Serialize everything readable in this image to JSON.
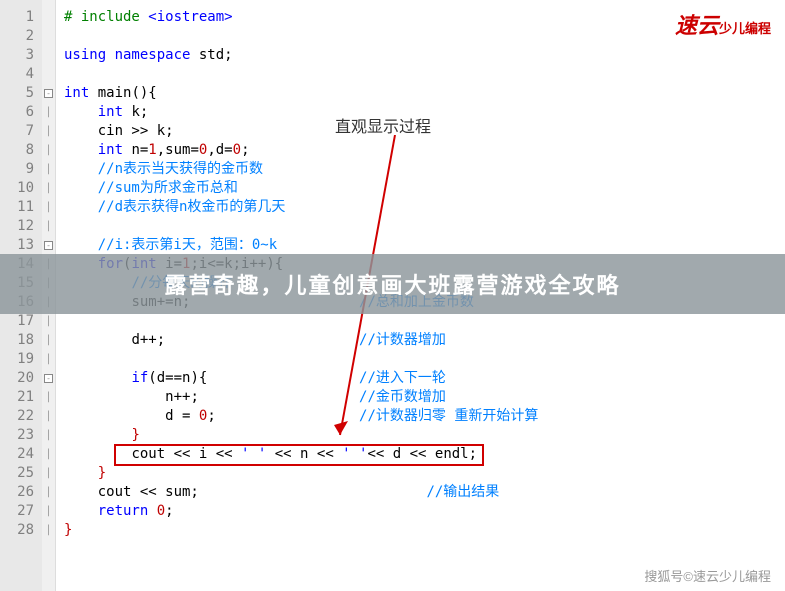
{
  "logo": {
    "brand": "速云",
    "tagline": "少儿编程"
  },
  "annotation": "直观显示过程",
  "banner": "露营奇趣，儿童创意画大班露营游戏全攻略",
  "watermark": "搜狐号©速云少儿编程",
  "gutter": [
    "1",
    "2",
    "3",
    "4",
    "5",
    "6",
    "7",
    "8",
    "9",
    "10",
    "11",
    "12",
    "13",
    "14",
    "15",
    "16",
    "17",
    "18",
    "19",
    "20",
    "21",
    "22",
    "23",
    "24",
    "25",
    "26",
    "27",
    "28"
  ],
  "fold": {
    "5": "-",
    "13": "-",
    "20": "-"
  },
  "code": {
    "l1": {
      "pp": "# include ",
      "str": "<iostream>"
    },
    "l3": {
      "kw1": "using ",
      "kw2": "namespace ",
      "id": "std",
      ";": ";"
    },
    "l5": {
      "kw": "int ",
      "id": "main",
      "rest": "(){"
    },
    "l6": {
      "kw": "int ",
      "rest": "k;"
    },
    "l7": "cin >> k;",
    "l8": {
      "kw": "int ",
      "rest": "n=",
      "n1": "1",
      "mid": ",sum=",
      "n2": "0",
      "mid2": ",d=",
      "n3": "0",
      "end": ";"
    },
    "l9": "//n表示当天获得的金币数",
    "l10": "//sum为所求金币总和",
    "l11": "//d表示获得n枚金币的第几天",
    "l13": "//i:表示第i天，范围：0~k",
    "l14": {
      "kw": "for",
      "rest": "(",
      "kw2": "int ",
      "body": "i=",
      "n": "1",
      "tail": ";i<=k;i++){"
    },
    "l15": "//分每天的操作",
    "l16": {
      "code": "sum+=n;",
      "cm": "//总和加上金币数"
    },
    "l18": {
      "code": "d++;",
      "cm": "//计数器增加"
    },
    "l20": {
      "kw": "if",
      "rest": "(d==n){",
      "cm": "//进入下一轮"
    },
    "l21": {
      "code": "n++;",
      "cm": "//金币数增加"
    },
    "l22": {
      "code": "d = ",
      "n": "0",
      "end": ";",
      "cm": "//计数器归零 重新开始计算"
    },
    "l23": "}",
    "l24": {
      "a": "cout << i << ",
      "q1": "' '",
      "b": " << n << ",
      "q2": "' '",
      "c": "<< d << endl;"
    },
    "l25": "}",
    "l26": {
      "code": "cout << sum;",
      "cm": "//输出结果"
    },
    "l27": {
      "kw": "return ",
      "n": "0",
      "end": ";"
    },
    "l28": "}"
  }
}
